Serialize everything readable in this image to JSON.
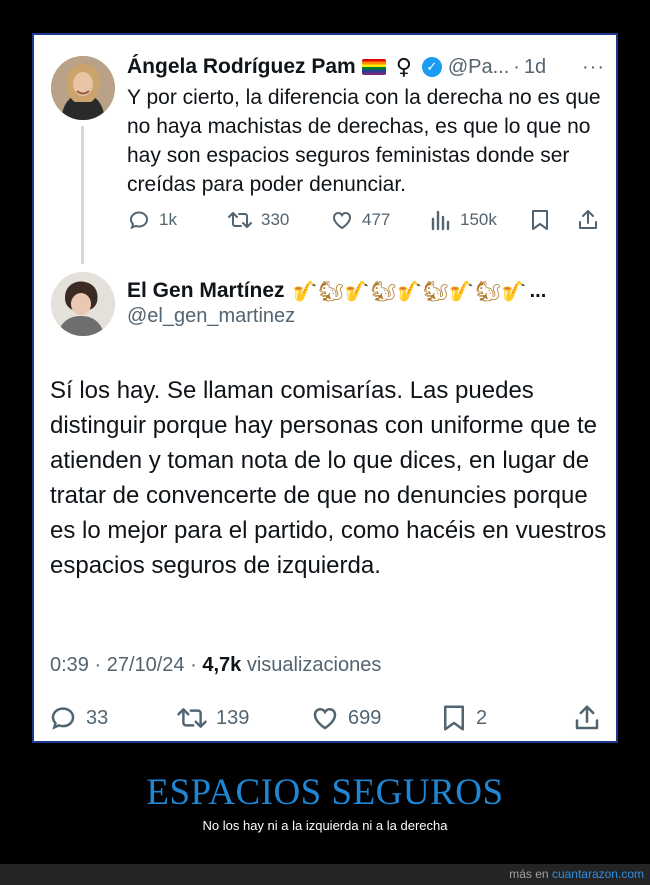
{
  "parent_tweet": {
    "author_name": "Ángela Rodríguez Pam",
    "author_emojis": [
      "rainbow-flag",
      "venus-symbol"
    ],
    "verified": true,
    "handle": "@Pa...",
    "separator": "·",
    "time": "1d",
    "more": "···",
    "text": "Y por cierto, la diferencia con la derecha no es que no haya machistas de derechas, es que lo que no hay son espacios seguros feministas donde ser creídas para poder denunciar.",
    "stats": {
      "replies": "1k",
      "retweets": "330",
      "likes": "477",
      "views": "150k"
    }
  },
  "main_tweet": {
    "author_name": "El Gen Martínez",
    "name_emojis": "🎷🐿🎷🐿🎷🐿🎷🐿🎷",
    "name_ellipsis": "...",
    "handle": "@el_gen_martinez",
    "text": "Sí los hay. Se llaman comisarías. Las puedes distinguir porque hay personas con uniforme que te atienden y toman nota de lo que dices, en lugar de tratar de convencerte de que no denuncies porque es lo mejor para el partido, como hacéis en vuestros espacios seguros de izquierda.",
    "meta_time": "0:39 · 27/10/24 · ",
    "meta_views_count": "4,7k",
    "meta_views_label": " visualizaciones",
    "stats": {
      "replies": "33",
      "retweets": "139",
      "likes": "699",
      "bookmarks": "2"
    }
  },
  "caption": {
    "title": "ESPACIOS SEGUROS",
    "subtitle": "No los hay ni a la izquierda ni a la derecha"
  },
  "footer": {
    "prefix": "más en ",
    "site": "cuantarazon.com"
  },
  "colors": {
    "background": "#000000",
    "card": "#ffffff",
    "frame_border": "#1d3b8c",
    "muted_text": "#536471",
    "verified_blue": "#1d9bf0",
    "caption_blue": "#1f86d4",
    "link_blue": "#2d8fe0"
  }
}
